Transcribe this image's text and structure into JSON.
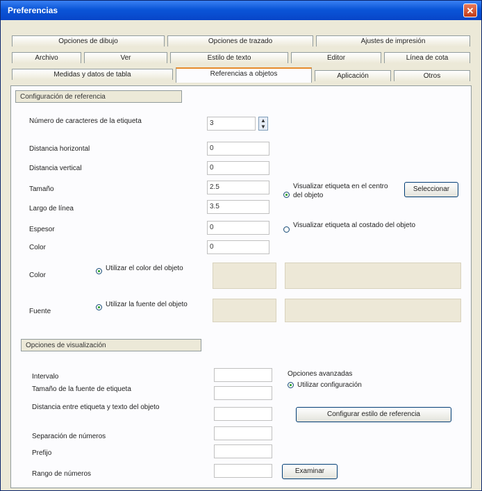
{
  "window": {
    "title": "Preferencias",
    "close_glyph": "✕"
  },
  "tabs": {
    "row1": [
      "Opciones de dibujo",
      "Opciones de trazado",
      "Ajustes de impresión"
    ],
    "row2": [
      "Archivo",
      "Ver",
      "Estilo de texto",
      "Editor",
      "Línea de cota"
    ],
    "row3": [
      "Medidas y datos de tabla",
      "Referencias a objetos",
      "Aplicación",
      "Otros"
    ],
    "active": "Referencias a objetos"
  },
  "group1": {
    "header": "Configuración de referencia",
    "rows": [
      {
        "label": "Número de caracteres de la etiqueta",
        "value": "3"
      },
      {
        "label": "Distancia horizontal",
        "value": "0"
      },
      {
        "label": "Distancia vertical",
        "value": "0"
      },
      {
        "label": "Tamaño",
        "value": "2.5"
      },
      {
        "label": "Largo de línea",
        "value": "3.5"
      },
      {
        "label": "Espesor",
        "value": "0"
      },
      {
        "label": "Color",
        "value": "0"
      }
    ],
    "color_row": {
      "label": "Color",
      "option": "Utilizar el color del objeto"
    },
    "font_row": {
      "label": "Fuente",
      "option": "Utilizar la fuente del objeto"
    },
    "radio1": "Visualizar etiqueta en el centro del objeto",
    "radio1_button": "Seleccionar",
    "radio2": "Visualizar etiqueta al costado del objeto"
  },
  "group2": {
    "header": "Opciones de visualización",
    "rows": [
      {
        "label": "Intervalo"
      },
      {
        "label": "Tamaño de la fuente de etiqueta"
      },
      {
        "label": "Distancia entre etiqueta y texto del objeto"
      },
      {
        "label": "Separación de números"
      },
      {
        "label": "Prefijo"
      },
      {
        "label": "Rango de números"
      }
    ],
    "right_title": "Opciones avanzadas",
    "right_radio": "Utilizar configuración",
    "right_button": "Configurar estilo de referencia",
    "bottom_button": "Examinar"
  }
}
